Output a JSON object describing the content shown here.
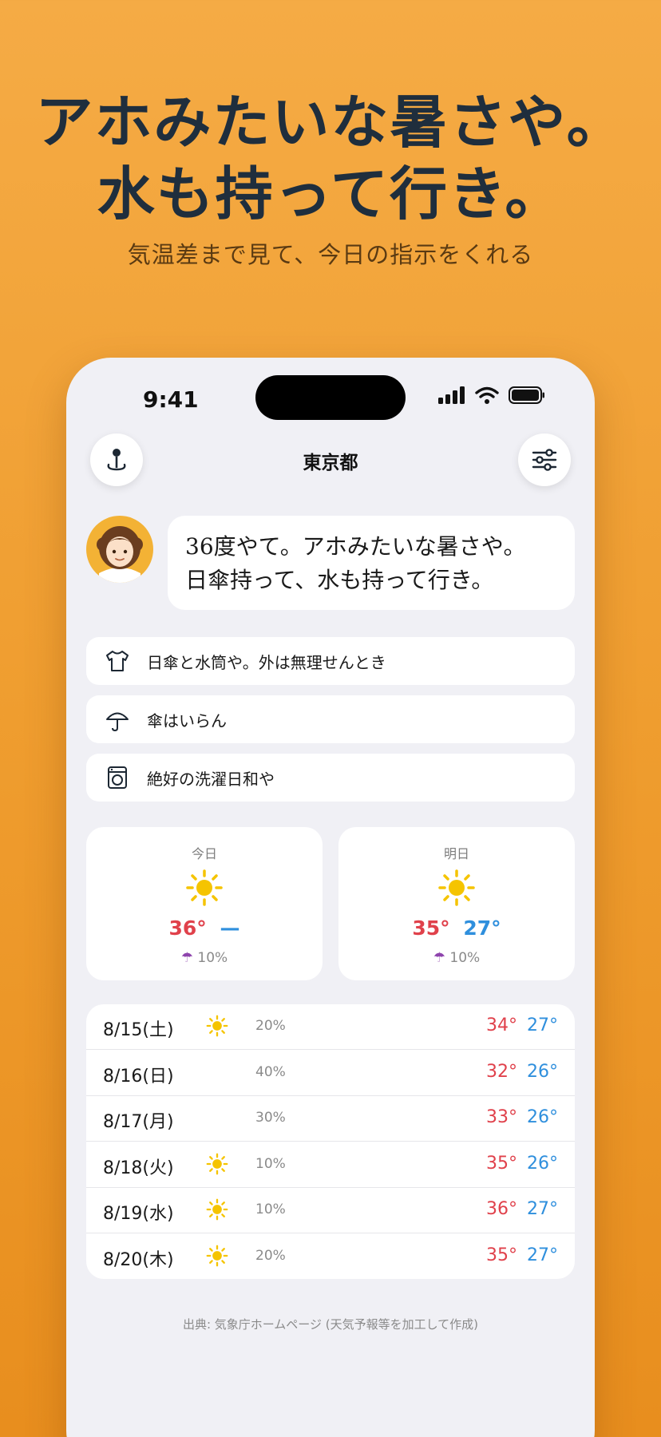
{
  "hero": {
    "line1": "アホみたいな暑さや。",
    "line2": "水も持って行き。",
    "subtitle": "気温差まで見て、今日の指示をくれる"
  },
  "status": {
    "time": "9:41"
  },
  "header": {
    "city": "東京都",
    "location_icon": "location-pin-icon",
    "settings_icon": "sliders-icon"
  },
  "message": {
    "line1": "36度やて。アホみたいな暑さや。",
    "line2": "日傘持って、水も持って行き。"
  },
  "tips": [
    {
      "icon": "shirt-icon",
      "text": "日傘と水筒や。外は無理せんとき"
    },
    {
      "icon": "umbrella-icon",
      "text": "傘はいらん"
    },
    {
      "icon": "washing-machine-icon",
      "text": "絶好の洗濯日和や"
    }
  ],
  "today": {
    "label": "今日",
    "icon": "sun-icon",
    "high": "36°",
    "low": "—",
    "rain": "10%"
  },
  "tomorrow": {
    "label": "明日",
    "icon": "sun-icon",
    "high": "35°",
    "low": "27°",
    "rain": "10%"
  },
  "forecast": [
    {
      "date": "8/15(土)",
      "sunny": true,
      "pop": "20%",
      "high": "34°",
      "low": "27°"
    },
    {
      "date": "8/16(日)",
      "sunny": false,
      "pop": "40%",
      "high": "32°",
      "low": "26°"
    },
    {
      "date": "8/17(月)",
      "sunny": false,
      "pop": "30%",
      "high": "33°",
      "low": "26°"
    },
    {
      "date": "8/18(火)",
      "sunny": true,
      "pop": "10%",
      "high": "35°",
      "low": "26°"
    },
    {
      "date": "8/19(水)",
      "sunny": true,
      "pop": "10%",
      "high": "36°",
      "low": "27°"
    },
    {
      "date": "8/20(木)",
      "sunny": true,
      "pop": "20%",
      "high": "35°",
      "low": "27°"
    }
  ],
  "source": "出典: 気象庁ホームページ (天気予報等を加工して作成)",
  "colors": {
    "high": "#e0414b",
    "low": "#2f8fdd",
    "sun": "#f5c400",
    "background": "#f0a235"
  }
}
